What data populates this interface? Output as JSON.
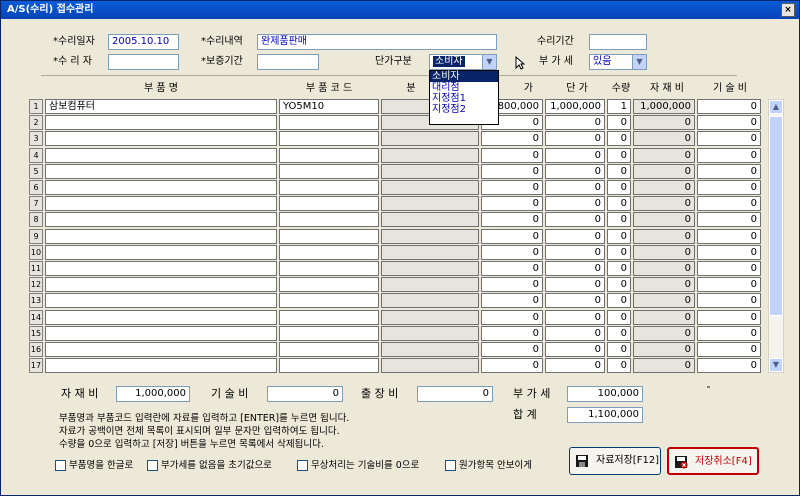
{
  "window": {
    "title": "A/S(수리) 접수관리",
    "close": "×"
  },
  "form": {
    "repair_date_label": "*수리일자",
    "repair_date": "2005.10.10",
    "repair_detail_label": "*수리내역",
    "repair_detail": "완제품판매",
    "repair_period_label": "수리기간",
    "repair_period": "",
    "repairer_label": "*수 리 자",
    "repairer": "",
    "warranty_label": "*보증기간",
    "warranty": "",
    "price_type_label": "단가구분",
    "price_type": "소비자",
    "vat_label": "부 가 세",
    "vat": "있음"
  },
  "dropdown_options": [
    "소비자",
    "대리점",
    "지정점1",
    "지정점2"
  ],
  "table": {
    "headers": {
      "name": "부 품 명",
      "code": "부 품 코 드",
      "class": "분",
      "price_a": "가",
      "unit_price": "단 가",
      "qty": "수량",
      "material": "자 재 비",
      "tech": "기 술 비"
    },
    "rows": [
      {
        "no": "1",
        "name": "삼보컴퓨터",
        "code": "YO5M10",
        "price": "800,000",
        "unit": "1,000,000",
        "qty": "1",
        "mat": "1,000,000",
        "tech": "0"
      },
      {
        "no": "2",
        "name": "",
        "code": "",
        "price": "0",
        "unit": "0",
        "qty": "0",
        "mat": "0",
        "tech": "0"
      },
      {
        "no": "3",
        "name": "",
        "code": "",
        "price": "0",
        "unit": "0",
        "qty": "0",
        "mat": "0",
        "tech": "0"
      },
      {
        "no": "4",
        "name": "",
        "code": "",
        "price": "0",
        "unit": "0",
        "qty": "0",
        "mat": "0",
        "tech": "0"
      },
      {
        "no": "5",
        "name": "",
        "code": "",
        "price": "0",
        "unit": "0",
        "qty": "0",
        "mat": "0",
        "tech": "0"
      },
      {
        "no": "6",
        "name": "",
        "code": "",
        "price": "0",
        "unit": "0",
        "qty": "0",
        "mat": "0",
        "tech": "0"
      },
      {
        "no": "7",
        "name": "",
        "code": "",
        "price": "0",
        "unit": "0",
        "qty": "0",
        "mat": "0",
        "tech": "0"
      },
      {
        "no": "8",
        "name": "",
        "code": "",
        "price": "0",
        "unit": "0",
        "qty": "0",
        "mat": "0",
        "tech": "0"
      },
      {
        "no": "9",
        "name": "",
        "code": "",
        "price": "0",
        "unit": "0",
        "qty": "0",
        "mat": "0",
        "tech": "0"
      },
      {
        "no": "10",
        "name": "",
        "code": "",
        "price": "0",
        "unit": "0",
        "qty": "0",
        "mat": "0",
        "tech": "0"
      },
      {
        "no": "11",
        "name": "",
        "code": "",
        "price": "0",
        "unit": "0",
        "qty": "0",
        "mat": "0",
        "tech": "0"
      },
      {
        "no": "12",
        "name": "",
        "code": "",
        "price": "0",
        "unit": "0",
        "qty": "0",
        "mat": "0",
        "tech": "0"
      },
      {
        "no": "13",
        "name": "",
        "code": "",
        "price": "0",
        "unit": "0",
        "qty": "0",
        "mat": "0",
        "tech": "0"
      },
      {
        "no": "14",
        "name": "",
        "code": "",
        "price": "0",
        "unit": "0",
        "qty": "0",
        "mat": "0",
        "tech": "0"
      },
      {
        "no": "15",
        "name": "",
        "code": "",
        "price": "0",
        "unit": "0",
        "qty": "0",
        "mat": "0",
        "tech": "0"
      },
      {
        "no": "16",
        "name": "",
        "code": "",
        "price": "0",
        "unit": "0",
        "qty": "0",
        "mat": "0",
        "tech": "0"
      },
      {
        "no": "17",
        "name": "",
        "code": "",
        "price": "0",
        "unit": "0",
        "qty": "0",
        "mat": "0",
        "tech": "0"
      }
    ]
  },
  "totals": {
    "material_label": "자 재 비",
    "material": "1,000,000",
    "tech_label": "기 술 비",
    "tech": "0",
    "travel_label": "출 장 비",
    "travel": "0",
    "vat_label": "부 가 세",
    "vat": "100,000",
    "sum_label": "합    계",
    "sum": "1,100,000"
  },
  "notes": [
    "부품명과 부품코드 입력란에 자료를 입력하고 [ENTER]를 누르면 됩니다.",
    "자료가 공백이면 전체 목록이 표시되며 일부 문자만 입력하여도 됩니다.",
    "수량을 0으로 입력하고 [저장] 버튼을 누르면 목록에서 삭제됩니다."
  ],
  "checkboxes": [
    "부품명을 한글로",
    "부가세를 없음을 초기값으로",
    "무상처리는 기술비를 0으로",
    "원가항목 안보이게"
  ],
  "buttons": {
    "save": "자료저장[F12]",
    "cancel": "저장취소[F4]"
  },
  "colors": {
    "title_bar": "#0843b8",
    "input_text": "#0000c0",
    "selection": "#0a246a",
    "cancel_text": "#c00000"
  }
}
